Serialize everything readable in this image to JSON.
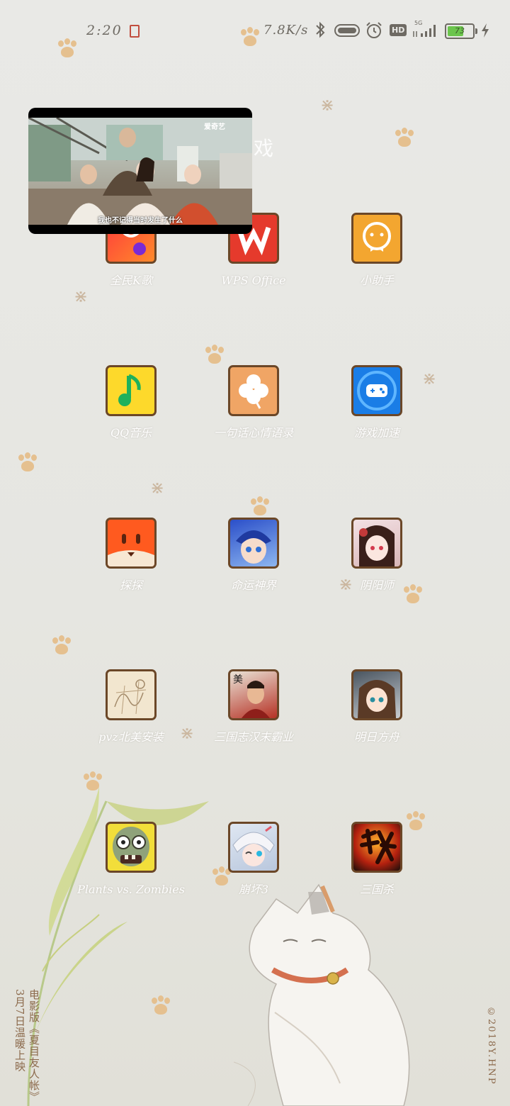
{
  "status_bar": {
    "time": "2:20",
    "network_speed": "7.8K/s",
    "network_type": "5G",
    "hd_label": "HD",
    "battery_level": "73",
    "battery_fraction": 0.73,
    "icons": [
      "notification-icon",
      "bluetooth-icon",
      "toggle-icon",
      "alarm-icon",
      "hd-icon",
      "signal-icon",
      "battery-icon",
      "charging-icon"
    ]
  },
  "folder": {
    "title_partial": "戏"
  },
  "pip": {
    "logo": "爱奇艺",
    "subtitle": "我也不记得当时发生了什么"
  },
  "apps": [
    {
      "label": "全民K歌",
      "icon": "karaoke-icon"
    },
    {
      "label": "WPS Office",
      "icon": "wps-icon"
    },
    {
      "label": "小助手",
      "icon": "assistant-icon"
    },
    {
      "label": "QQ音乐",
      "icon": "music-note-icon"
    },
    {
      "label": "一句话心情语录",
      "icon": "clover-icon"
    },
    {
      "label": "游戏加速",
      "icon": "gamepad-icon"
    },
    {
      "label": "探探",
      "icon": "fox-icon"
    },
    {
      "label": "命运神界",
      "icon": "anime-boy-icon"
    },
    {
      "label": "阴阳师",
      "icon": "anime-girl-icon"
    },
    {
      "label": "pvz北美安装",
      "icon": "sketch-icon"
    },
    {
      "label": "三国志汉末霸业",
      "icon": "warrior-icon"
    },
    {
      "label": "明日方舟",
      "icon": "operator-icon"
    },
    {
      "label": "Plants vs. Zombies",
      "icon": "zombie-icon"
    },
    {
      "label": "崩坏3",
      "icon": "valkyrie-icon"
    },
    {
      "label": "三国杀",
      "icon": "sha-icon"
    }
  ],
  "wallpaper": {
    "left_text_1": "3月7日温暖上映",
    "left_text_2": "电影版《夏目友人帐》",
    "copyright": "©2018Y.HNP"
  },
  "colors": {
    "accent_brown": "#6b4728",
    "paw": "#e5c08f",
    "battery_green": "#6cc54d"
  }
}
